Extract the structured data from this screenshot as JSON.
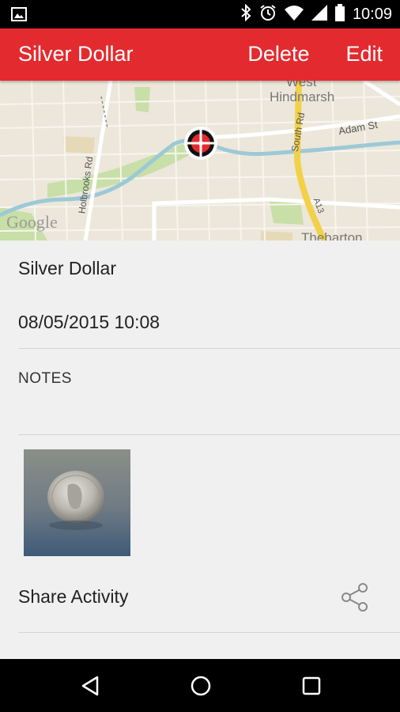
{
  "status_bar": {
    "time": "10:09",
    "icons": [
      "image-notification-icon",
      "bluetooth-icon",
      "alarm-icon",
      "wifi-icon",
      "cell-signal-icon",
      "battery-icon"
    ]
  },
  "app_bar": {
    "title": "Silver Dollar",
    "delete_label": "Delete",
    "edit_label": "Edit",
    "color": "#e32b2f"
  },
  "map": {
    "watermark": "Google",
    "labels": {
      "west": "West",
      "hindmarsh": "Hindmarsh",
      "adam_st": "Adam St",
      "south_rd": "South Rd",
      "holbrooks_rd": "Holbrooks Rd",
      "a13": "A13",
      "thebarton": "Thebarton"
    },
    "marker_icon": "crosshair-marker-icon"
  },
  "detail": {
    "title": "Silver Dollar",
    "datetime": "08/05/2015 10:08",
    "notes_label": "NOTES",
    "share_label": "Share Activity"
  },
  "nav_bar": {
    "icons": [
      "back-icon",
      "home-icon",
      "recents-icon"
    ]
  }
}
